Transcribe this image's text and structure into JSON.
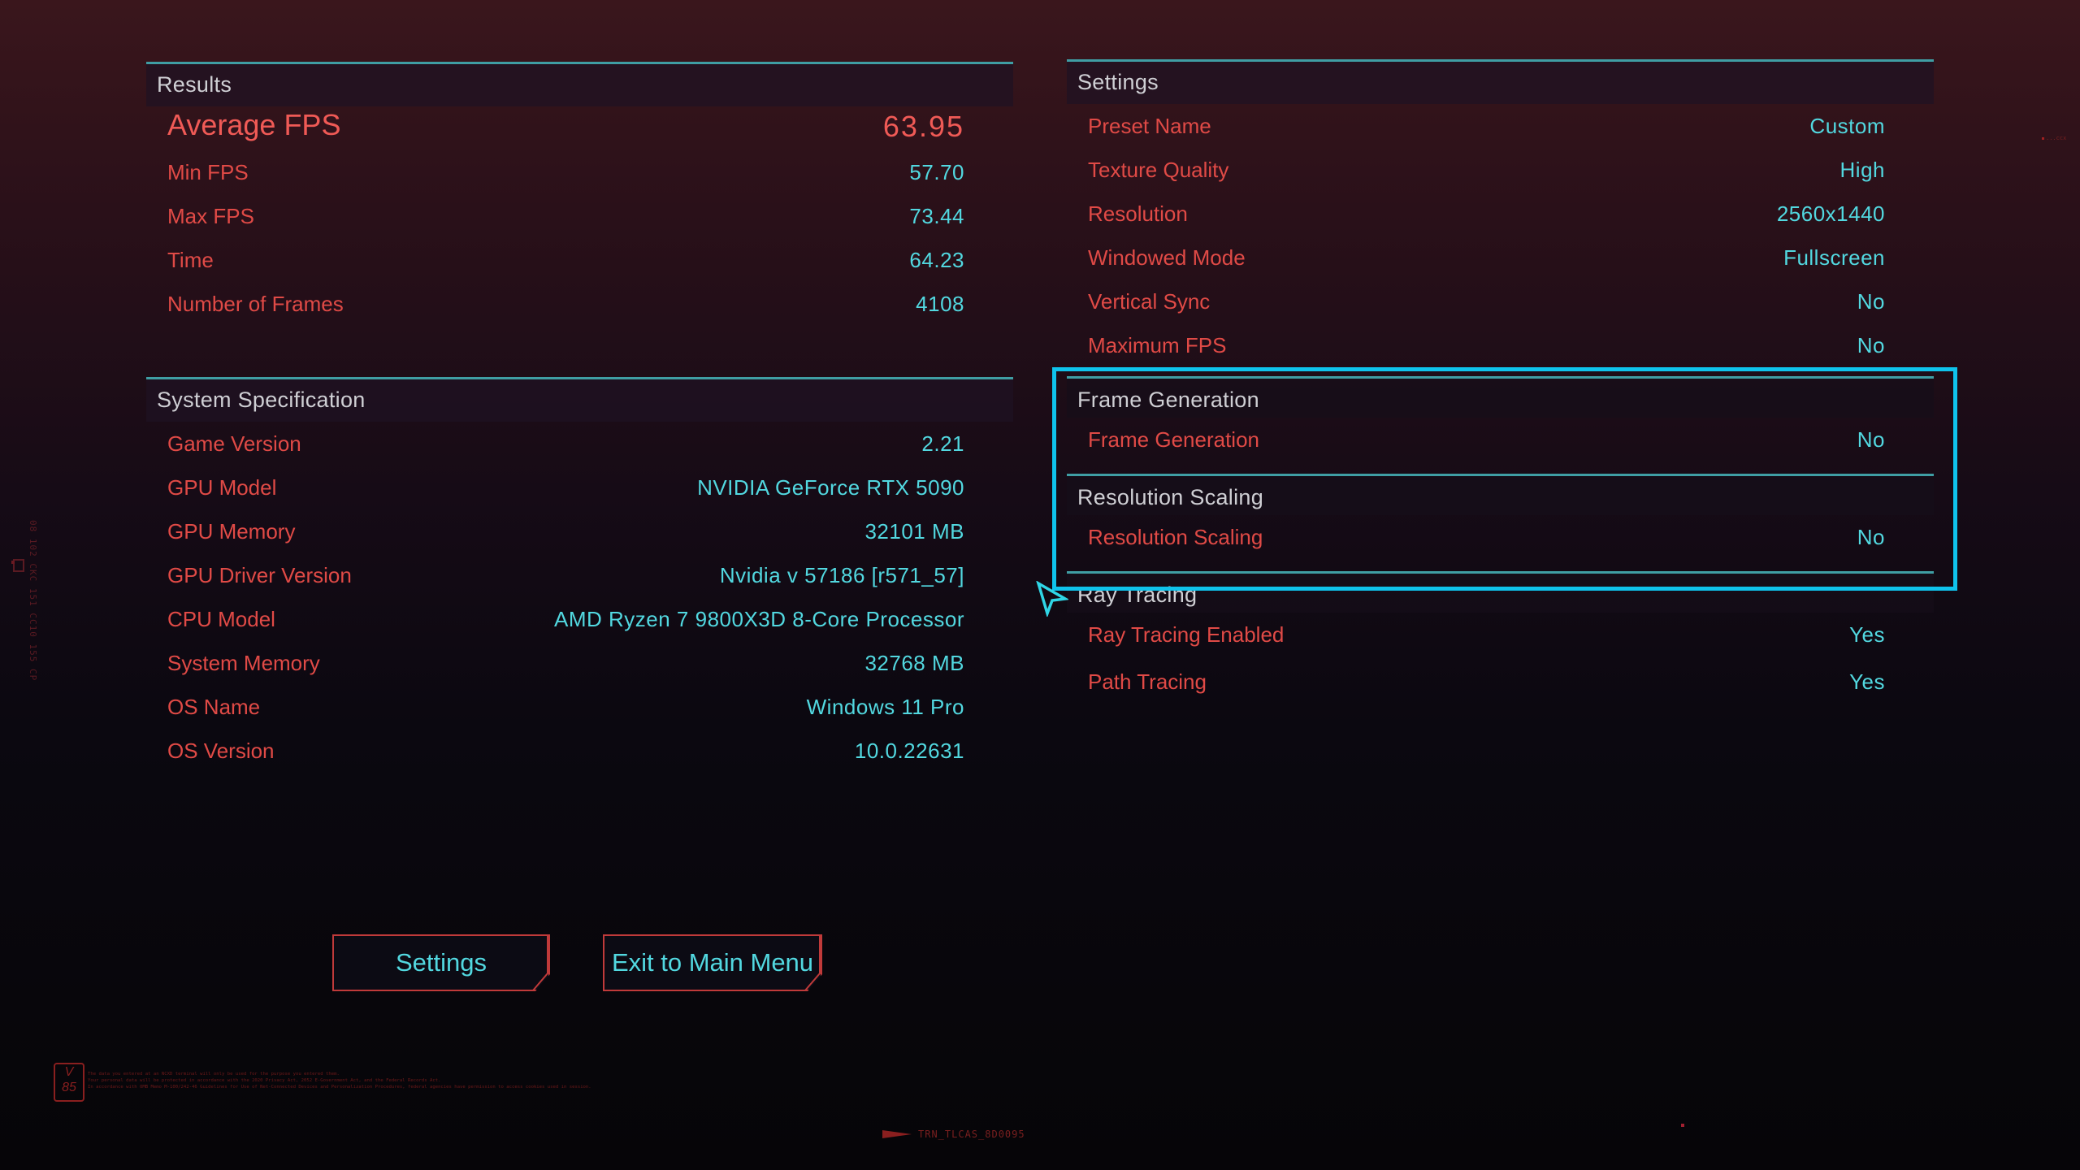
{
  "results": {
    "title": "Results",
    "average_fps": {
      "label": "Average FPS",
      "value": "63.95"
    },
    "rows": [
      {
        "label": "Min FPS",
        "value": "57.70"
      },
      {
        "label": "Max FPS",
        "value": "73.44"
      },
      {
        "label": "Time",
        "value": "64.23"
      },
      {
        "label": "Number of Frames",
        "value": "4108"
      }
    ]
  },
  "system_specification": {
    "title": "System Specification",
    "rows": [
      {
        "label": "Game Version",
        "value": "2.21"
      },
      {
        "label": "GPU Model",
        "value": "NVIDIA GeForce RTX 5090"
      },
      {
        "label": "GPU Memory",
        "value": "32101 MB"
      },
      {
        "label": "GPU Driver Version",
        "value": "Nvidia v 57186 [r571_57]"
      },
      {
        "label": "CPU Model",
        "value": "AMD Ryzen 7 9800X3D 8-Core Processor"
      },
      {
        "label": "System Memory",
        "value": "32768 MB"
      },
      {
        "label": "OS Name",
        "value": "Windows 11 Pro"
      },
      {
        "label": "OS Version",
        "value": "10.0.22631"
      }
    ]
  },
  "settings": {
    "title": "Settings",
    "rows": [
      {
        "label": "Preset Name",
        "value": "Custom"
      },
      {
        "label": "Texture Quality",
        "value": "High"
      },
      {
        "label": "Resolution",
        "value": "2560x1440"
      },
      {
        "label": "Windowed Mode",
        "value": "Fullscreen"
      },
      {
        "label": "Vertical Sync",
        "value": "No"
      },
      {
        "label": "Maximum FPS",
        "value": "No"
      }
    ]
  },
  "frame_generation": {
    "title": "Frame Generation",
    "rows": [
      {
        "label": "Frame Generation",
        "value": "No"
      }
    ]
  },
  "resolution_scaling": {
    "title": "Resolution Scaling",
    "rows": [
      {
        "label": "Resolution Scaling",
        "value": "No"
      }
    ]
  },
  "ray_tracing": {
    "title": "Ray Tracing",
    "rows": [
      {
        "label": "Ray Tracing Enabled",
        "value": "Yes"
      },
      {
        "label": "Path Tracing",
        "value": "Yes"
      }
    ]
  },
  "buttons": {
    "settings": "Settings",
    "exit": "Exit to Main Menu"
  },
  "decor": {
    "logo": "V 85",
    "logo_line1": "V",
    "logo_line2": "85",
    "fineprint": [
      "The data you entered at an NCXD terminal will only be used for the purpose you entered them.",
      "Your personal data will be protected in accordance with the 2020 Privacy Act, 2052 E-Government Act, and the Federal Records Act.",
      "In accordance with OMB Memo M-100/242-46 Guidelines for Use of Net-Connected Devices and Personalization Procedures, federal agencies have permission to access cookies used in session."
    ],
    "vertical_code": "08 102 CKC 151 CC10 155 CP",
    "footer_code": "TRN_TLCAS_8D0095",
    "corner_mark": "...ccx"
  },
  "colors": {
    "label_red": "#e04a46",
    "value_cyan": "#52d8e0",
    "highlight_cyan": "#0fc3ec",
    "divider_teal": "#3f9ea4",
    "button_border": "#c03a3a"
  }
}
